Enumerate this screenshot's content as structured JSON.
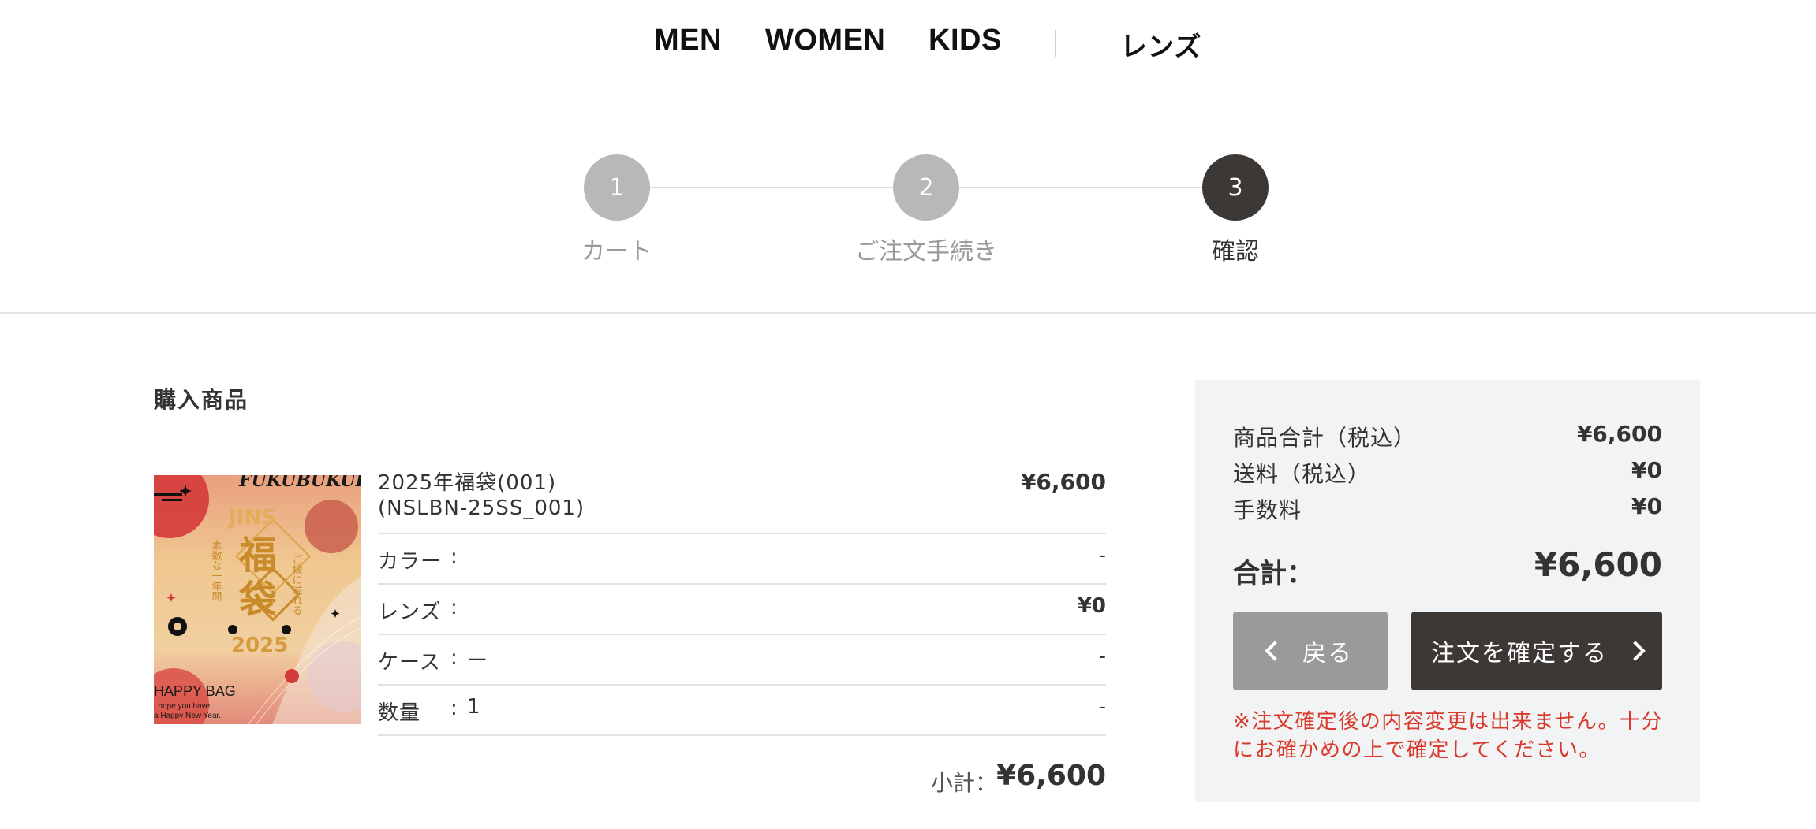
{
  "nav": {
    "items": [
      "MEN",
      "WOMEN",
      "KIDS"
    ],
    "lens": "レンズ"
  },
  "stepper": {
    "steps": [
      {
        "number": "1",
        "label": "カート",
        "status": "done"
      },
      {
        "number": "2",
        "label": "ご注文手続き",
        "status": "done"
      },
      {
        "number": "3",
        "label": "確認",
        "status": "current"
      }
    ]
  },
  "colors": {
    "step_inactive": "#b8b8b8",
    "step_active": "#3c3836",
    "accent_red": "#d9392b",
    "panel_bg": "#f2f3f4"
  },
  "purchase": {
    "section_title": "購入商品",
    "product": {
      "name_line1": "2025年福袋(001)",
      "name_line2": "(NSLBN-25SS_001)",
      "price": "¥6,600",
      "image": {
        "top_text": "FUKUBUKURO",
        "brand": "JINS",
        "kanji1": "福",
        "kanji2": "袋",
        "year": "2025",
        "side_right": "ご縁に溢れる",
        "side_left": "素敵な一年間",
        "bottom_title": "HAPPY BAG",
        "bottom_line1": "I hope you have",
        "bottom_line2": "a Happy New Year."
      }
    },
    "rows": [
      {
        "label": "カラー",
        "value": "",
        "right": "-"
      },
      {
        "label": "レンズ",
        "value": "",
        "right": "¥0"
      },
      {
        "label": "ケース",
        "value": "ー",
        "right": "-"
      },
      {
        "label": "数量",
        "value": "1",
        "right": "-"
      }
    ],
    "colon": ":",
    "subtotal_label": "小計：",
    "subtotal_value": "¥6,600"
  },
  "summary": {
    "rows": [
      {
        "label": "商品合計（税込）",
        "value": "¥6,600"
      },
      {
        "label": "送料（税込）",
        "value": "¥0"
      },
      {
        "label": "手数料",
        "value": "¥0"
      }
    ],
    "total_label": "合計：",
    "total_value": "¥6,600",
    "back_button": "戻る",
    "confirm_button": "注文を確定する",
    "notice": "※注文確定後の内容変更は出来ません。十分にお確かめの上で確定してください。"
  }
}
